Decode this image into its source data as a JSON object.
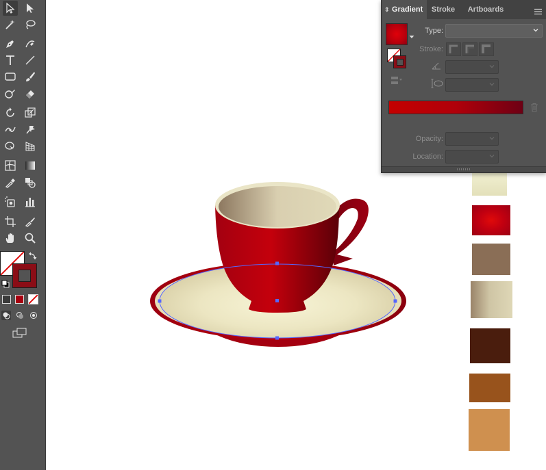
{
  "panel": {
    "tabs": [
      {
        "label": "Gradient"
      },
      {
        "label": "Stroke"
      },
      {
        "label": "Artboards"
      }
    ],
    "type_label": "Type:",
    "type_value": "",
    "stroke_label": "Stroke:",
    "opacity_label": "Opacity:",
    "location_label": "Location:",
    "gradient": {
      "start_color": "#c40000",
      "end_color": "#6e0014"
    }
  },
  "toolbar": {
    "fill_color": "#ffffff",
    "stroke_color": "#8b0d16",
    "tools": [
      "selection-tool-icon",
      "direct-selection-tool-icon",
      "magic-wand-tool-icon",
      "lasso-tool-icon",
      "pen-tool-icon",
      "curvature-tool-icon",
      "type-tool-icon",
      "line-segment-tool-icon",
      "rectangle-tool-icon",
      "paintbrush-tool-icon",
      "shaper-tool-icon",
      "eraser-tool-icon",
      "rotate-tool-icon",
      "scale-tool-icon",
      "width-tool-icon",
      "puppet-warp-tool-icon",
      "shape-builder-tool-icon",
      "perspective-grid-tool-icon",
      "mesh-tool-icon",
      "gradient-tool-icon",
      "eyedropper-tool-icon",
      "blend-tool-icon",
      "symbol-sprayer-tool-icon",
      "column-graph-tool-icon",
      "artboard-tool-icon",
      "slice-tool-icon",
      "hand-tool-icon",
      "zoom-tool-icon"
    ]
  },
  "swatches": [
    {
      "name": "cream-gradient",
      "colors": [
        "#f4f3d6",
        "#e3e0ba"
      ]
    },
    {
      "name": "red-radial",
      "colors": [
        "#e00a0a",
        "#a30012"
      ]
    },
    {
      "name": "mocha",
      "colors": [
        "#8a6e56"
      ]
    },
    {
      "name": "tan-gradient",
      "colors": [
        "#9a8469",
        "#ded7b6"
      ]
    },
    {
      "name": "dark-brown",
      "colors": [
        "#4a1d0d"
      ]
    },
    {
      "name": "rust-brown",
      "colors": [
        "#98531c"
      ]
    },
    {
      "name": "caramel",
      "colors": [
        "#cf904f"
      ]
    }
  ],
  "artwork": {
    "cup_red": "#b5000c",
    "cup_dark": "#5e0008",
    "saucer_cream": "#ecE7c4",
    "selection_color": "#5566ff"
  }
}
